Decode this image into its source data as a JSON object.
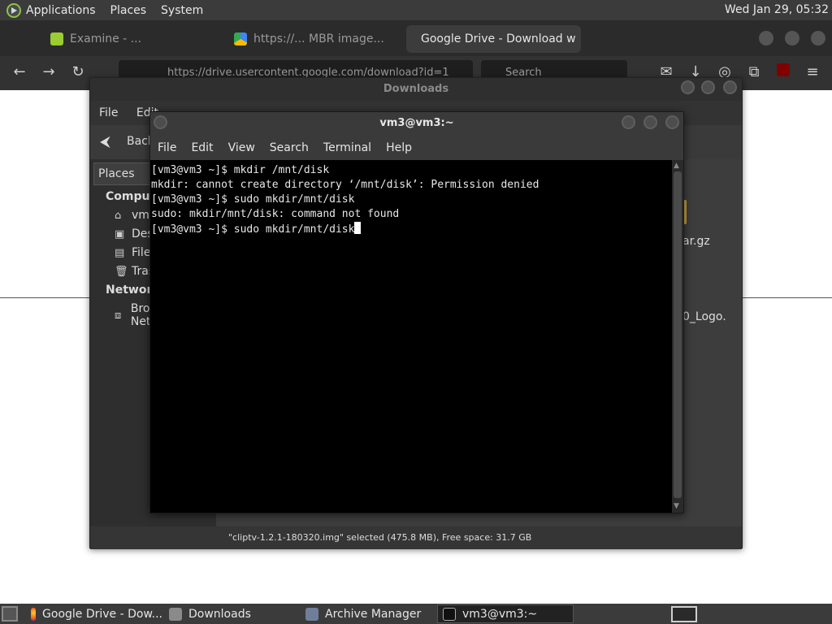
{
  "top_panel": {
    "menus": [
      "Applications",
      "Places",
      "System"
    ],
    "clock": "Wed Jan 29, 05:32"
  },
  "browser": {
    "tabs": [
      {
        "label": "Examine - ...",
        "icon": "tab-app-icon"
      },
      {
        "label": "https://... MBR image...",
        "icon": "google-drive-icon"
      },
      {
        "label": "Google Drive - Download w",
        "icon": "google-drive-icon",
        "active": true
      }
    ],
    "url": "https://drive.usercontent.google.com/download?id=1",
    "search_placeholder": "Search"
  },
  "file_manager": {
    "title": "Downloads",
    "menus": [
      "File",
      "Edit"
    ],
    "back_label": "Back",
    "sidebar_header": "Places",
    "sections": [
      {
        "heading": "Computer",
        "items": [
          {
            "label": "vm3",
            "icon": "home-icon"
          },
          {
            "label": "Desktop",
            "icon": "desktop-icon"
          },
          {
            "label": "File System",
            "icon": "drive-icon"
          },
          {
            "label": "Trash",
            "icon": "trash-icon"
          }
        ]
      },
      {
        "heading": "Network",
        "items": [
          {
            "label": "Browse Network",
            "icon": "network-icon"
          }
        ]
      }
    ],
    "visible_files": [
      "ar.gz",
      "0_Logo."
    ],
    "status": "\"cliptv-1.2.1-180320.img\" selected (475.8 MB), Free space: 31.7 GB"
  },
  "terminal": {
    "title": "vm3@vm3:~",
    "menus": [
      "File",
      "Edit",
      "View",
      "Search",
      "Terminal",
      "Help"
    ],
    "lines": [
      "[vm3@vm3 ~]$ mkdir /mnt/disk",
      "mkdir: cannot create directory ‘/mnt/disk’: Permission denied",
      "[vm3@vm3 ~]$ sudo mkdir/mnt/disk",
      "sudo: mkdir/mnt/disk: command not found",
      "[vm3@vm3 ~]$ sudo mkdir/mnt/disk"
    ]
  },
  "taskbar": {
    "tasks": [
      {
        "label": "Google Drive - Dow...",
        "icon": "firefox-icon"
      },
      {
        "label": "Downloads",
        "icon": "folder-icon"
      },
      {
        "label": "Archive Manager",
        "icon": "archive-icon"
      },
      {
        "label": "vm3@vm3:~",
        "icon": "terminal-icon",
        "active": true
      }
    ]
  },
  "colors": {
    "panel_bg": "#3b3b3b",
    "terminal_bg": "#000000",
    "terminal_text": "#e8e8e8",
    "accent_orange": "#f29111"
  }
}
